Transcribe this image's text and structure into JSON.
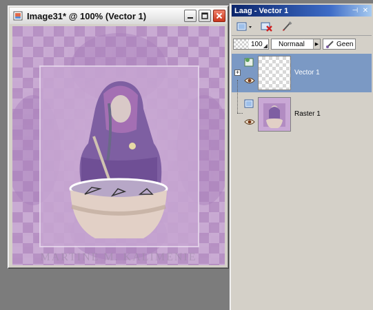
{
  "document": {
    "title": "Image31* @ 100% (Vector 1)",
    "watermark": "MARTINE M. KALIMENIE"
  },
  "layers_palette": {
    "title": "Laag - Vector 1",
    "opacity": "100",
    "blend_mode": "Normaal",
    "mask_label": "Geen",
    "layers": [
      {
        "name": "Vector 1",
        "type": "vector",
        "selected": true
      },
      {
        "name": "Raster 1",
        "type": "raster",
        "selected": false
      }
    ]
  },
  "colors": {
    "selection": "#7b99c4",
    "titlebar_active": "#0a246a",
    "close_button": "#d0452a",
    "canvas_purple": "#c6a9cf"
  }
}
